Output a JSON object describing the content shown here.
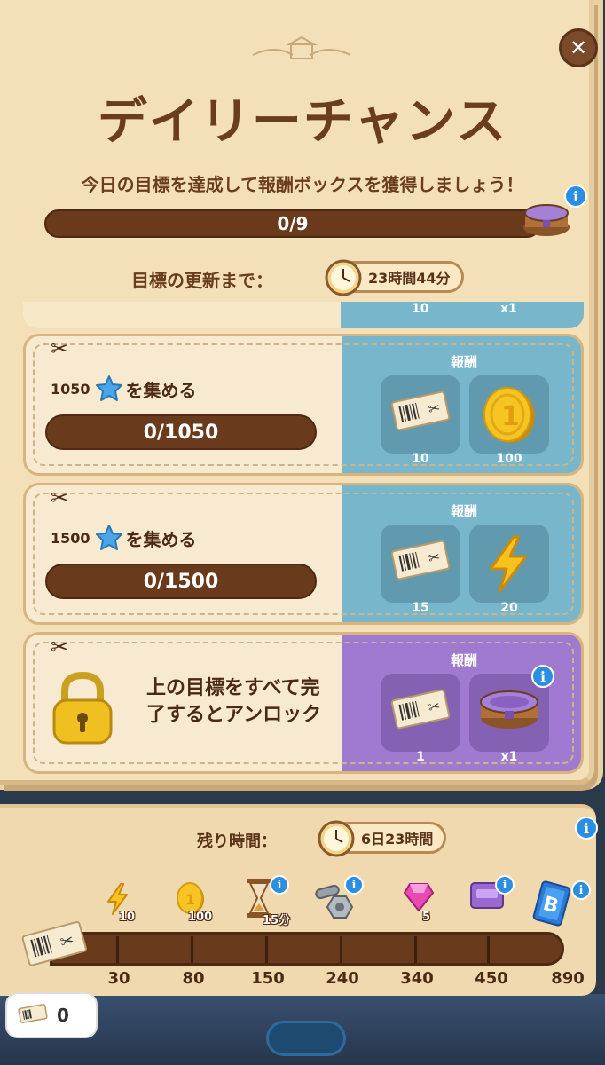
{
  "title": "デイリーチャンス",
  "subtitle": "今日の目標を達成して報酬ボックスを獲得しましょう！",
  "main_progress": {
    "text": "0/9",
    "value": 0,
    "max": 9
  },
  "refresh": {
    "label": "目標の更新まで：",
    "time": "23時間44分"
  },
  "list_top": {
    "left_count": "10",
    "right_count": "x1"
  },
  "quests": [
    {
      "goal_number": "1050",
      "goal_text": "を集める",
      "progress_text": "0/1050",
      "reward_title": "報酬",
      "rewards": [
        {
          "icon": "ticket-icon",
          "count": "10"
        },
        {
          "icon": "gold-coin-icon",
          "count": "100"
        }
      ]
    },
    {
      "goal_number": "1500",
      "goal_text": "を集める",
      "progress_text": "0/1500",
      "reward_title": "報酬",
      "rewards": [
        {
          "icon": "ticket-icon",
          "count": "15"
        },
        {
          "icon": "lightning-icon",
          "count": "20"
        }
      ]
    }
  ],
  "locked_quest": {
    "text": "上の目標をすべて完了するとアンロック",
    "reward_title": "報酬",
    "rewards": [
      {
        "icon": "ticket-icon",
        "count": "1"
      },
      {
        "icon": "chest-icon",
        "count": "x1"
      }
    ]
  },
  "season": {
    "remain_label": "残り時間：",
    "remain_time": "6日23時間",
    "milestones": [
      {
        "value": "30",
        "icon": "lightning-icon",
        "count": "10"
      },
      {
        "value": "80",
        "icon": "gold-coin-icon",
        "count": "100"
      },
      {
        "value": "150",
        "icon": "hourglass-icon",
        "count": "15分"
      },
      {
        "value": "240",
        "icon": "nut-bolt-icon",
        "count": ""
      },
      {
        "value": "340",
        "icon": "gem-icon",
        "count": "5"
      },
      {
        "value": "450",
        "icon": "purple-box-icon",
        "count": ""
      },
      {
        "value": "890",
        "icon": "b-card-icon",
        "count": ""
      }
    ],
    "ticket_count": "0"
  },
  "colors": {
    "parchment": "#f3dfb8",
    "brown_dark": "#6a3a1c",
    "blue_reward": "#78b6cc",
    "purple_reward": "#a07ad0",
    "info_blue": "#2a8fe0"
  }
}
